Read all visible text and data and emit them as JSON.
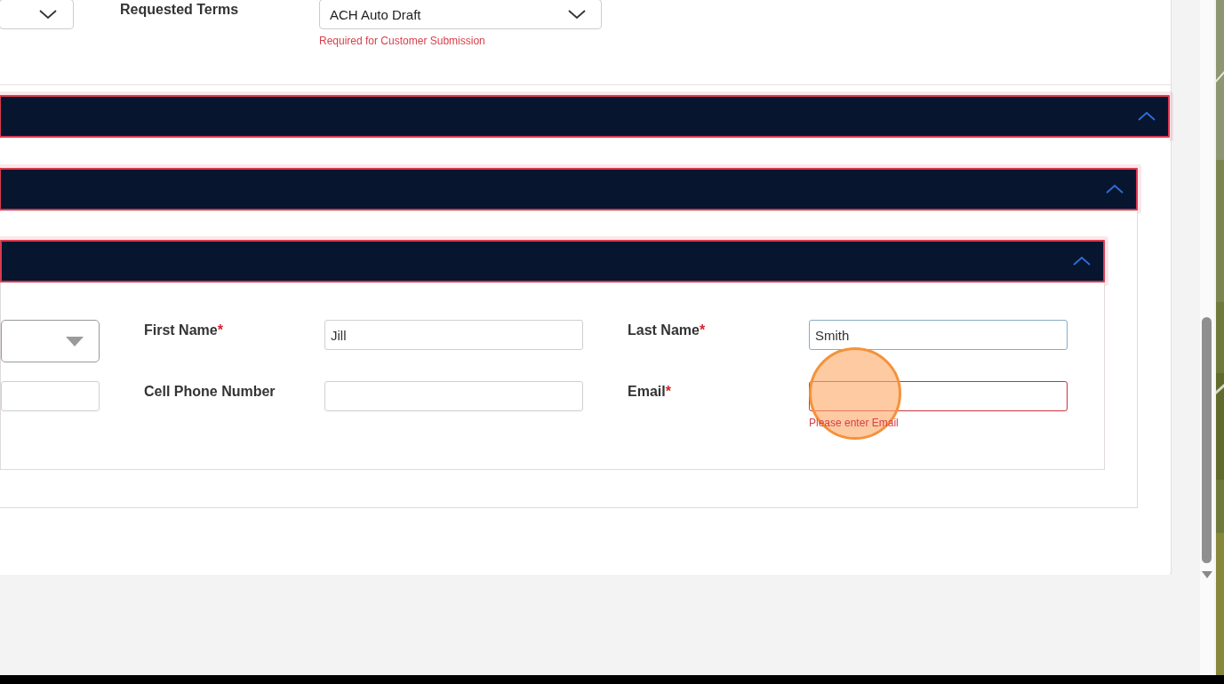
{
  "top_row": {
    "dropdown_1": {
      "kind": "dropdown"
    },
    "requested_terms": {
      "label": "Requested Terms",
      "value": "ACH Auto Draft",
      "error": "Required for Customer Submission"
    }
  },
  "sections": [
    {
      "expanded": true
    },
    {
      "expanded": true
    },
    {
      "expanded": true
    }
  ],
  "contact_fields": [
    {
      "kind": "dropdown"
    },
    {
      "kind": "text",
      "label": "First Name",
      "required_mark": "*",
      "value": "Jill",
      "focused": false,
      "invalid": false
    },
    {
      "kind": "text",
      "label": "Last Name",
      "required_mark": "*",
      "value": "Smith",
      "focused": true,
      "invalid": false
    },
    {
      "kind": "text"
    },
    {
      "kind": "text",
      "label": "Cell Phone Number",
      "focused": false,
      "invalid": false
    },
    {
      "kind": "text",
      "label": "Email",
      "required_mark": "*",
      "focused": false,
      "invalid": true,
      "error": "Please enter Email"
    }
  ]
}
